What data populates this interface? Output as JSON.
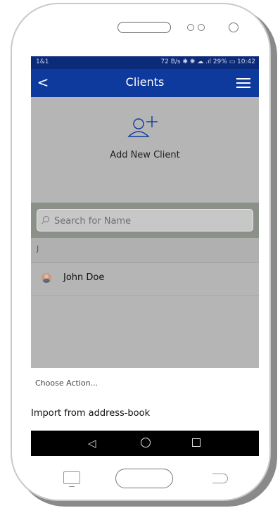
{
  "status_bar": {
    "carrier": "1&1",
    "right": "72 B/s ✱ ✺ ☁ .ıl 29% ▭ 10:42"
  },
  "app_bar": {
    "back_icon": "chevron-left-icon",
    "back_glyph": "<",
    "title": "Clients",
    "menu_icon": "hamburger-menu-icon"
  },
  "add_client": {
    "icon": "add-person-icon",
    "label": "Add New Client"
  },
  "search": {
    "placeholder": "Search for Name",
    "value": ""
  },
  "list": {
    "section_letter": "J",
    "items": [
      {
        "name": "John Doe",
        "avatar": "person-avatar"
      }
    ]
  },
  "action_sheet": {
    "title": "Choose Action...",
    "actions": [
      "Import from address-book"
    ]
  },
  "nav_bar": {
    "back_glyph": "◁",
    "home_icon": "circle-home-icon",
    "recent_icon": "square-recents-icon"
  },
  "colors": {
    "status_bar": "#0b2a7a",
    "app_bar": "#0e3a9e",
    "screen_bg": "#b5b5b5",
    "search_band": "#8b9189"
  }
}
